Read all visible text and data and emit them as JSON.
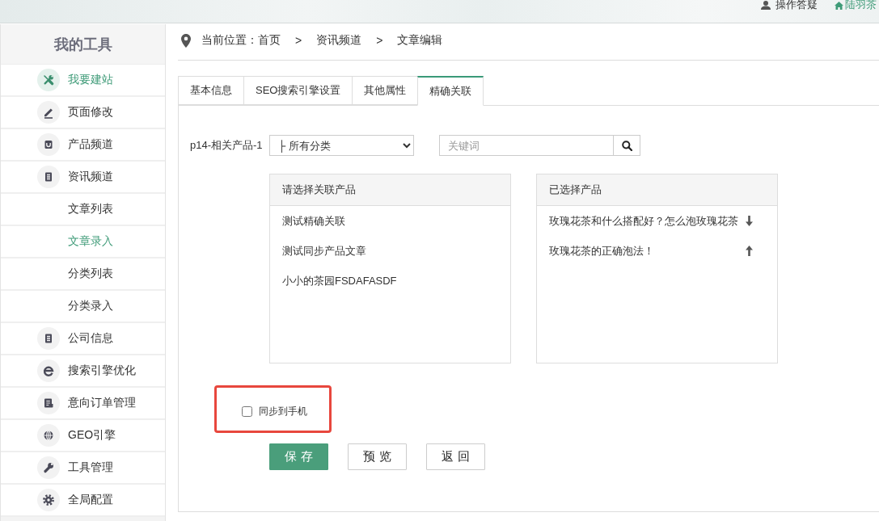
{
  "header": {
    "links": [
      {
        "kind": "help",
        "label": "操作答疑"
      },
      {
        "kind": "home",
        "label": "陆羽茶"
      }
    ]
  },
  "sidebar": {
    "title": "我的工具",
    "items": [
      {
        "kind": "site",
        "label": "我要建站",
        "selected": true
      },
      {
        "kind": "page",
        "label": "页面修改",
        "selected": false
      },
      {
        "kind": "product",
        "label": "产品频道",
        "selected": false
      },
      {
        "kind": "news",
        "label": "资讯频道",
        "selected": false,
        "children": [
          {
            "label": "文章列表",
            "selected": false
          },
          {
            "label": "文章录入",
            "selected": true
          },
          {
            "label": "分类列表",
            "selected": false
          },
          {
            "label": "分类录入",
            "selected": false
          }
        ]
      },
      {
        "kind": "company",
        "label": "公司信息",
        "selected": false
      },
      {
        "kind": "seo",
        "label": "搜索引擎优化",
        "selected": false
      },
      {
        "kind": "order",
        "label": "意向订单管理",
        "selected": false
      },
      {
        "kind": "geo",
        "label": "GEO引擎",
        "selected": false
      },
      {
        "kind": "tool",
        "label": "工具管理",
        "selected": false
      },
      {
        "kind": "config",
        "label": "全局配置",
        "selected": false
      }
    ]
  },
  "breadcrumb": {
    "label": "当前位置：",
    "items": [
      {
        "kind": "link",
        "text": "首页"
      },
      {
        "kind": "separator",
        "text": ">"
      },
      {
        "kind": "link",
        "text": "资讯频道"
      },
      {
        "kind": "separator",
        "text": ">"
      },
      {
        "kind": "current",
        "text": "文章编辑"
      }
    ]
  },
  "tabs": [
    {
      "label": "基本信息",
      "selected": false
    },
    {
      "label": "SEO搜索引擎设置",
      "selected": false
    },
    {
      "label": "其他属性",
      "selected": false
    },
    {
      "label": "精确关联",
      "selected": true
    }
  ],
  "relation": {
    "label": "p14-相关产品-1",
    "category_select": {
      "value": "├ 所有分类"
    },
    "search": {
      "placeholder": "关键词"
    },
    "available": {
      "title": "请选择关联产品",
      "items": [
        "测试精确关联",
        "测试同步产品文章",
        "小小的茶园FSDAFASDF"
      ]
    },
    "chosen": {
      "title": "已选择产品",
      "items": [
        {
          "text": "玫瑰花茶和什么搭配好？怎么泡玫瑰花茶",
          "kind": "move_down"
        },
        {
          "text": "玫瑰花茶的正确泡法！",
          "kind": "move_up"
        }
      ]
    },
    "sync_option": {
      "label": "同步到手机",
      "checked": false,
      "annotated": true
    },
    "buttons": [
      {
        "label": "保存",
        "kind": "primary"
      },
      {
        "label": "预览",
        "kind": "default"
      },
      {
        "label": "返回",
        "kind": "default"
      }
    ]
  }
}
